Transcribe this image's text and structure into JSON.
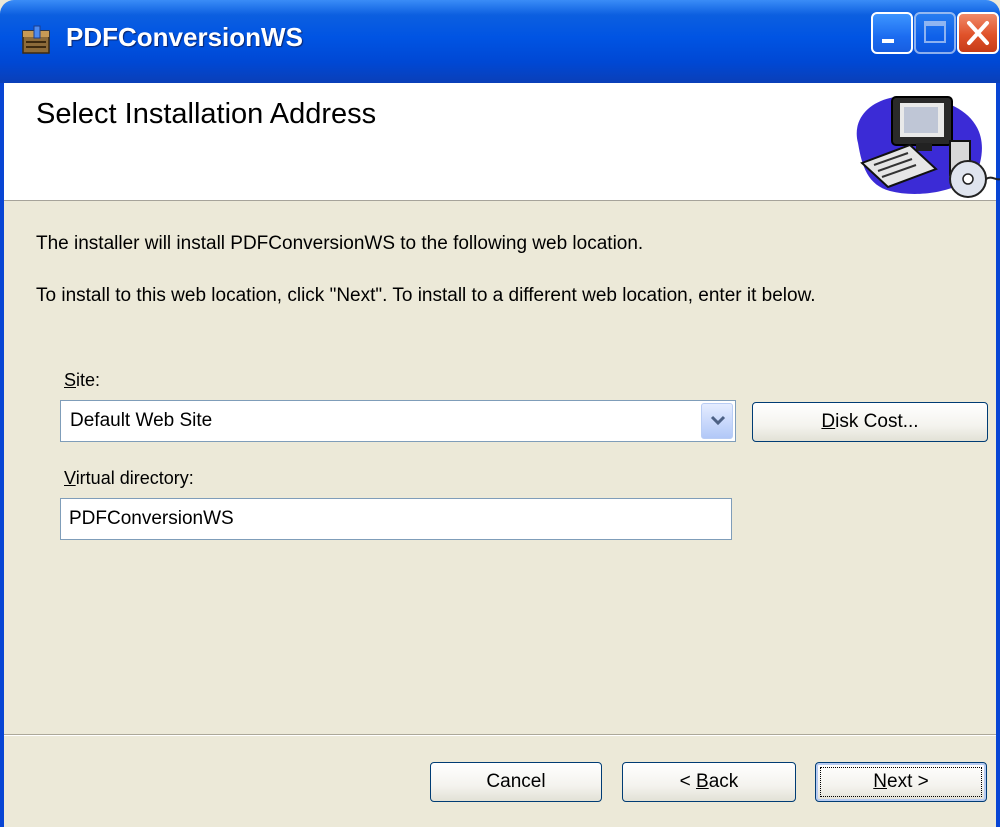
{
  "window": {
    "title": "PDFConversionWS",
    "controls": [
      "minimize-icon",
      "maximize-icon",
      "close-icon"
    ]
  },
  "banner": {
    "title": "Select Installation Address",
    "graphic": "computer-cd-icon"
  },
  "body": {
    "line1": "The installer will install PDFConversionWS to the following web location.",
    "line2": "To install to this web location, click \"Next\". To install to a different web location, enter it below."
  },
  "site": {
    "label_access": "S",
    "label_rest": "ite:",
    "value": "Default Web Site"
  },
  "virtual_directory": {
    "label_access": "V",
    "label_rest": "irtual directory:",
    "value": "PDFConversionWS"
  },
  "buttons": {
    "disk_cost_access": "D",
    "disk_cost_rest": "isk Cost...",
    "cancel": "Cancel",
    "back_prefix": "< ",
    "back_access": "B",
    "back_rest": "ack",
    "next_access": "N",
    "next_rest": "ext >"
  },
  "colors": {
    "titlebar": "#0054e3",
    "dialog_bg": "#ece9d8",
    "close_button": "#e0522a"
  }
}
